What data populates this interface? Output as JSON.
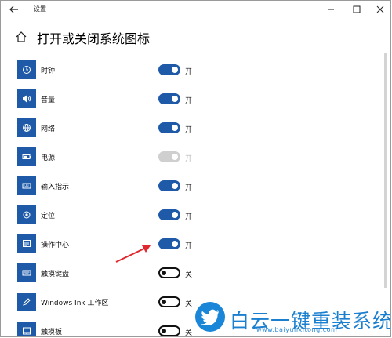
{
  "window": {
    "title": "设置",
    "controls": {
      "minimize": "—",
      "maximize": "☐",
      "close": "✕"
    }
  },
  "page": {
    "title": "打开或关闭系统图标"
  },
  "items": [
    {
      "label": "时钟",
      "icon": "clock-icon",
      "state": "开",
      "toggle": "on"
    },
    {
      "label": "音量",
      "icon": "volume-icon",
      "state": "开",
      "toggle": "on"
    },
    {
      "label": "网络",
      "icon": "globe-icon",
      "state": "开",
      "toggle": "on"
    },
    {
      "label": "电源",
      "icon": "battery-icon",
      "state": "开",
      "toggle": "disabled-on"
    },
    {
      "label": "输入指示",
      "icon": "keyboard-icon",
      "state": "开",
      "toggle": "on"
    },
    {
      "label": "定位",
      "icon": "location-icon",
      "state": "开",
      "toggle": "on"
    },
    {
      "label": "操作中心",
      "icon": "action-center-icon",
      "state": "开",
      "toggle": "on"
    },
    {
      "label": "触摸键盘",
      "icon": "touch-keyboard-icon",
      "state": "关",
      "toggle": "off"
    },
    {
      "label": "Windows Ink 工作区",
      "icon": "pen-icon",
      "state": "关",
      "toggle": "off"
    },
    {
      "label": "触摸板",
      "icon": "touchpad-icon",
      "state": "关",
      "toggle": "off"
    }
  ],
  "watermark": {
    "text": "白云一键重装系统",
    "url": "www.baiyunxitong.com"
  },
  "colors": {
    "accent": "#1e5aa8",
    "watermark": "#1b7fd0",
    "arrow": "#e0282e"
  }
}
